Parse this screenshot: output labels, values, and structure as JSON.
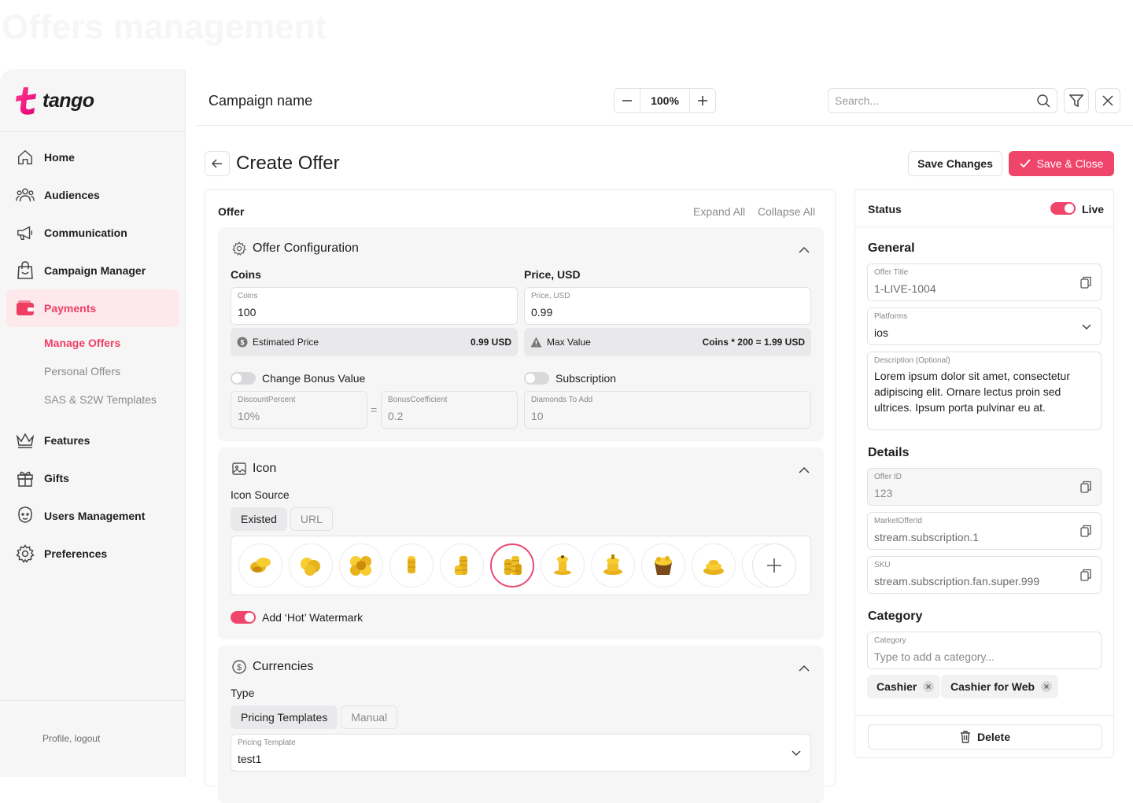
{
  "page": {
    "title": "Offers management"
  },
  "brand": {
    "name": "tango",
    "accent": "#ee3f63"
  },
  "sidebar": {
    "items": [
      {
        "label": "Home",
        "icon": "home-icon"
      },
      {
        "label": "Audiences",
        "icon": "users-icon"
      },
      {
        "label": "Communication",
        "icon": "megaphone-icon"
      },
      {
        "label": "Campaign Manager",
        "icon": "bag-icon"
      },
      {
        "label": "Payments",
        "icon": "wallet-icon",
        "active": true
      },
      {
        "label": "Features",
        "icon": "crown-icon"
      },
      {
        "label": "Gifts",
        "icon": "gift-icon"
      },
      {
        "label": "Users Management",
        "icon": "user-face-icon"
      },
      {
        "label": "Preferences",
        "icon": "gear-icon"
      }
    ],
    "subitems": [
      {
        "label": "Manage Offers",
        "active": true
      },
      {
        "label": "Personal Offers"
      },
      {
        "label": "SAS & S2W Templates"
      }
    ],
    "profile": "Profile, logout"
  },
  "topbar": {
    "campaign_name": "Campaign name",
    "zoom": "100%",
    "search_placeholder": "Search..."
  },
  "header": {
    "title": "Create Offer",
    "save_changes": "Save Changes",
    "save_close": "Save & Close"
  },
  "offer": {
    "label": "Offer",
    "expand_all": "Expand All",
    "collapse_all": "Collapse All",
    "config": {
      "title": "Offer Configuration",
      "coins_label": "Coins",
      "coins_field_label": "Coins",
      "coins_value": "100",
      "price_label": "Price, USD",
      "price_field_label": "Price, USD",
      "price_value": "0.99",
      "estimated_label": "Estimated Price",
      "estimated_value": "0.99 USD",
      "max_label": "Max Value",
      "max_value": "Coins * 200 = 1.99 USD",
      "bonus_toggle": "Change Bonus Value",
      "bonus_on": false,
      "subscription_toggle": "Subscription",
      "subscription_on": false,
      "discount_label": "DiscountPercent",
      "discount_value": "10%",
      "equals": "=",
      "coef_label": "BonusCoefficient",
      "coef_value": "0.2",
      "diamonds_label": "Diamonds To Add",
      "diamonds_value": "10"
    },
    "icon": {
      "title": "Icon",
      "source_label": "Icon Source",
      "source_options": [
        "Existed",
        "URL"
      ],
      "source_selected": "Existed",
      "coin_icons": [
        "coins-pile-1",
        "coins-pile-2",
        "coins-pile-3",
        "coin-stack-1",
        "coin-stack-2",
        "coin-stack-3",
        "coin-tower-1",
        "coin-tower-2",
        "coin-chest",
        "coin-heap",
        "coin-bag"
      ],
      "selected_index": 5,
      "watermark_label": "Add ‘Hot’ Watermark",
      "watermark_on": true
    },
    "currencies": {
      "title": "Currencies",
      "type_label": "Type",
      "type_options": [
        "Pricing Templates",
        "Manual"
      ],
      "type_selected": "Pricing Templates",
      "template_label": "Pricing Template",
      "template_value": "test1"
    }
  },
  "right": {
    "status_label": "Status",
    "status_value": "Live",
    "status_on": true,
    "general": "General",
    "offer_title_label": "Offer Title",
    "offer_title_value": "1-LIVE-1004",
    "platforms_label": "Platforms",
    "platforms_value": "ios",
    "description_label": "Description (Optional)",
    "description_value": "Lorem ipsum dolor sit amet, consectetur adipiscing elit. Ornare lectus proin sed ultrices. Ipsum porta pulvinar eu at.",
    "details": "Details",
    "offer_id_label": "Offer ID",
    "offer_id_value": "123",
    "market_label": "MarketOfferId",
    "market_value": "stream.subscription.1",
    "sku_label": "SKU",
    "sku_value": "stream.subscription.fan.super.999",
    "category": "Category",
    "category_label": "Category",
    "category_placeholder": "Type to add a category...",
    "chips": [
      "Cashier",
      "Cashier for Web"
    ],
    "delete": "Delete"
  }
}
